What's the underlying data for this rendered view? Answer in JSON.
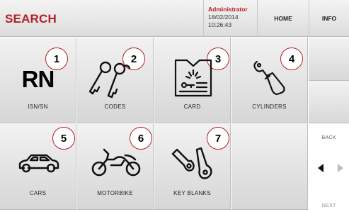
{
  "header": {
    "title": "SEARCH",
    "user": "Administrator",
    "date": "18/02/2014",
    "time": "10:26:43",
    "home_label": "HOME",
    "info_label": "INFO"
  },
  "tiles": [
    {
      "number": "1",
      "label": "ISN/SN",
      "icon": "rn-icon"
    },
    {
      "number": "2",
      "label": "CODES",
      "icon": "keys-icon"
    },
    {
      "number": "3",
      "label": "CARD",
      "icon": "card-icon"
    },
    {
      "number": "4",
      "label": "CYLINDERS",
      "icon": "cylinder-icon"
    },
    {
      "number": "5",
      "label": "CARS",
      "icon": "car-icon"
    },
    {
      "number": "6",
      "label": "MOTORBIKE",
      "icon": "motorbike-icon"
    },
    {
      "number": "7",
      "label": "KEY BLANKS",
      "icon": "key-blanks-icon"
    }
  ],
  "rn_text": "RN",
  "nav": {
    "back_label": "BACK",
    "next_label": "NEXT"
  },
  "colors": {
    "accent": "#b51f25"
  }
}
